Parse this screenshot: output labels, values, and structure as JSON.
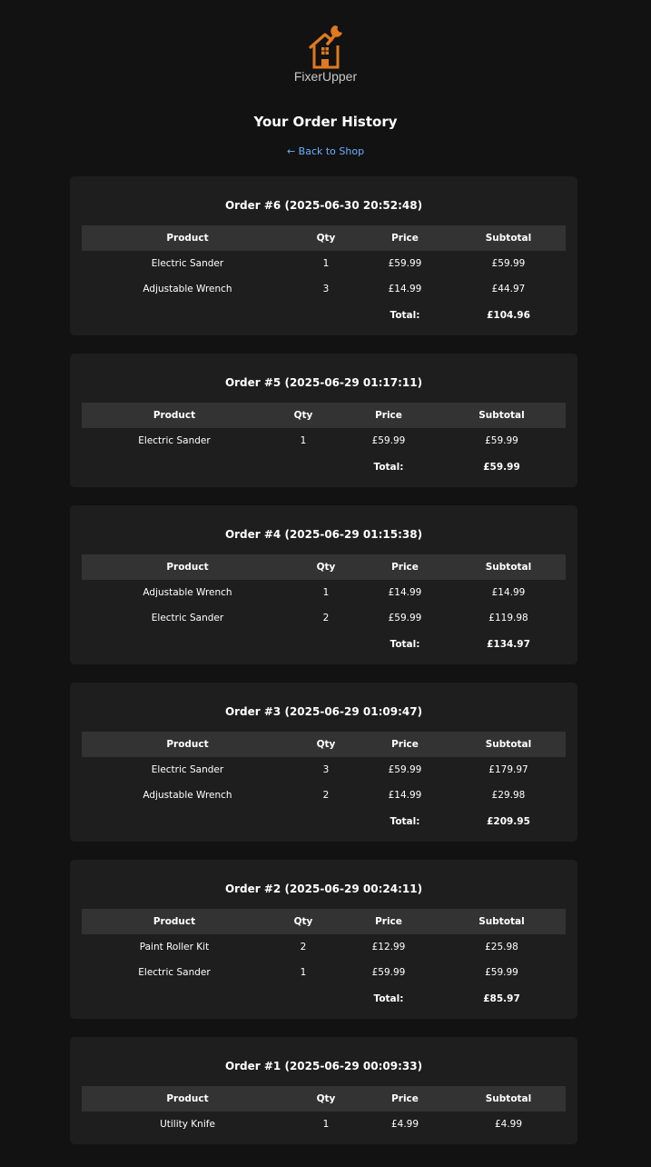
{
  "brand": {
    "name": "FixerUpper",
    "logo_icon": "house-wrench-icon",
    "accent": "#e07a1f"
  },
  "page_title": "Your Order History",
  "back_link": "← Back to Shop",
  "table_headers": {
    "product": "Product",
    "qty": "Qty",
    "price": "Price",
    "subtotal": "Subtotal",
    "total": "Total:"
  },
  "orders": [
    {
      "title": "Order #6 (2025-06-30 20:52:48)",
      "items": [
        {
          "product": "Electric Sander",
          "qty": "1",
          "price": "£59.99",
          "subtotal": "£59.99"
        },
        {
          "product": "Adjustable Wrench",
          "qty": "3",
          "price": "£14.99",
          "subtotal": "£44.97"
        }
      ],
      "total": "£104.96"
    },
    {
      "title": "Order #5 (2025-06-29 01:17:11)",
      "items": [
        {
          "product": "Electric Sander",
          "qty": "1",
          "price": "£59.99",
          "subtotal": "£59.99"
        }
      ],
      "total": "£59.99"
    },
    {
      "title": "Order #4 (2025-06-29 01:15:38)",
      "items": [
        {
          "product": "Adjustable Wrench",
          "qty": "1",
          "price": "£14.99",
          "subtotal": "£14.99"
        },
        {
          "product": "Electric Sander",
          "qty": "2",
          "price": "£59.99",
          "subtotal": "£119.98"
        }
      ],
      "total": "£134.97"
    },
    {
      "title": "Order #3 (2025-06-29 01:09:47)",
      "items": [
        {
          "product": "Electric Sander",
          "qty": "3",
          "price": "£59.99",
          "subtotal": "£179.97"
        },
        {
          "product": "Adjustable Wrench",
          "qty": "2",
          "price": "£14.99",
          "subtotal": "£29.98"
        }
      ],
      "total": "£209.95"
    },
    {
      "title": "Order #2 (2025-06-29 00:24:11)",
      "items": [
        {
          "product": "Paint Roller Kit",
          "qty": "2",
          "price": "£12.99",
          "subtotal": "£25.98"
        },
        {
          "product": "Electric Sander",
          "qty": "1",
          "price": "£59.99",
          "subtotal": "£59.99"
        }
      ],
      "total": "£85.97"
    },
    {
      "title": "Order #1 (2025-06-29 00:09:33)",
      "items": [
        {
          "product": "Utility Knife",
          "qty": "1",
          "price": "£4.99",
          "subtotal": "£4.99"
        }
      ],
      "total": ""
    }
  ]
}
